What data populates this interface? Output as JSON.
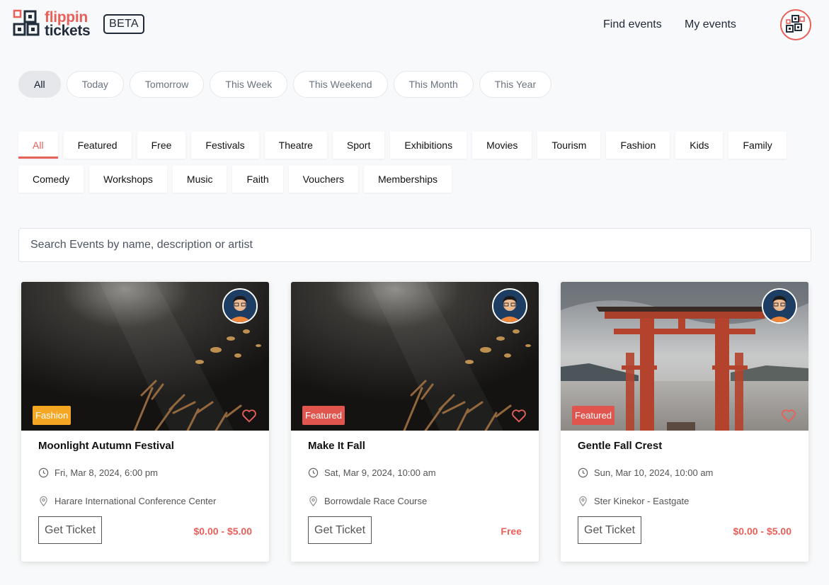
{
  "brand": {
    "line1": "flippin",
    "line2": "tickets",
    "beta": "BETA",
    "accent": "#e8605a",
    "dark": "#232e3c"
  },
  "nav": {
    "find_events": "Find events",
    "my_events": "My events",
    "avatar_icon": "qr-logo-icon"
  },
  "date_filters": [
    {
      "label": "All",
      "active": true
    },
    {
      "label": "Today",
      "active": false
    },
    {
      "label": "Tomorrow",
      "active": false
    },
    {
      "label": "This Week",
      "active": false
    },
    {
      "label": "This Weekend",
      "active": false
    },
    {
      "label": "This Month",
      "active": false
    },
    {
      "label": "This Year",
      "active": false
    }
  ],
  "categories_row1": [
    {
      "label": "All",
      "active": true
    },
    {
      "label": "Featured",
      "active": false
    },
    {
      "label": "Free",
      "active": false
    },
    {
      "label": "Festivals",
      "active": false
    },
    {
      "label": "Theatre",
      "active": false
    },
    {
      "label": "Sport",
      "active": false
    },
    {
      "label": "Exhibitions",
      "active": false
    },
    {
      "label": "Movies",
      "active": false
    },
    {
      "label": "Tourism",
      "active": false
    },
    {
      "label": "Fashion",
      "active": false
    },
    {
      "label": "Kids",
      "active": false
    },
    {
      "label": "Family",
      "active": false
    }
  ],
  "categories_row2": [
    {
      "label": "Comedy",
      "active": false
    },
    {
      "label": "Workshops",
      "active": false
    },
    {
      "label": "Music",
      "active": false
    },
    {
      "label": "Faith",
      "active": false
    },
    {
      "label": "Vouchers",
      "active": false
    },
    {
      "label": "Memberships",
      "active": false
    }
  ],
  "search": {
    "placeholder": "Search Events by name, description or artist",
    "value": ""
  },
  "events": [
    {
      "image": "concert",
      "badge": "Fashion",
      "badge_color": "#f5a623",
      "title": "Moonlight Autumn Festival",
      "date": "Fri, Mar 8, 2024, 6:00 pm",
      "venue": "Harare International Conference Center",
      "button": "Get Ticket",
      "price": "$0.00 - $5.00"
    },
    {
      "image": "concert",
      "badge": "Featured",
      "badge_color": "#e0554d",
      "title": "Make It Fall",
      "date": "Sat, Mar 9, 2024, 10:00 am",
      "venue": "Borrowdale Race Course",
      "button": "Get Ticket",
      "price": "Free"
    },
    {
      "image": "torii-gate",
      "badge": "Featured",
      "badge_color": "#e0554d",
      "title": "Gentle Fall Crest",
      "date": "Sun, Mar 10, 2024, 10:00 am",
      "venue": "Ster Kinekor - Eastgate",
      "button": "Get Ticket",
      "price": "$0.00 - $5.00"
    }
  ]
}
